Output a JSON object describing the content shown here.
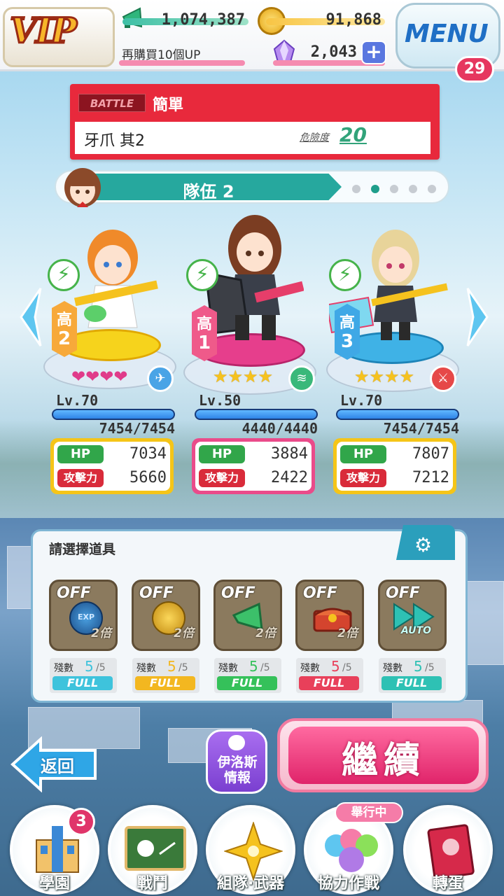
{
  "topbar": {
    "vip": "VIP",
    "cheer_value": "1,074,387",
    "coin_value": "91,868",
    "buy_up": "再購買10個UP",
    "gem_value": "2,043",
    "plus": "+",
    "menu_label": "MENU",
    "menu_badge": "29"
  },
  "battle": {
    "tag": "BATTLE",
    "difficulty": "簡單",
    "stage": "牙爪 其2",
    "danger_label": "危險度",
    "danger_value": "20"
  },
  "team": {
    "name": "隊伍 2",
    "page_count": 5,
    "active_page": 2
  },
  "characters": [
    {
      "rank_label": "高",
      "rank_num": "2",
      "rarity": "hearts",
      "rarity_count": 4,
      "level": "Lv.70",
      "hp_current": "7454/7454",
      "hp_fill": 1.0,
      "hp_label": "HP",
      "hp": "7034",
      "atk_label": "攻擊力",
      "atk": "5660",
      "type_icon": "gun-icon",
      "frame_color": "#f5c518",
      "ped_color": "#f7d21a"
    },
    {
      "rank_label": "高",
      "rank_num": "1",
      "rarity": "stars",
      "rarity_count": 4,
      "level": "Lv.50",
      "hp_current": "4440/4440",
      "hp_fill": 1.0,
      "hp_label": "HP",
      "hp": "3884",
      "atk_label": "攻擊力",
      "atk": "2422",
      "type_icon": "claw-icon",
      "frame_color": "#ea4b8a",
      "ped_color": "#ea3f8a"
    },
    {
      "rank_label": "高",
      "rank_num": "3",
      "rarity": "stars",
      "rarity_count": 4,
      "level": "Lv.70",
      "hp_current": "7454/7454",
      "hp_fill": 1.0,
      "hp_label": "HP",
      "hp": "7807",
      "atk_label": "攻擊力",
      "atk": "7212",
      "type_icon": "sword-icon",
      "frame_color": "#f5c518",
      "ped_color": "#3fb2e6"
    }
  ],
  "items_panel": {
    "title": "請選擇道具",
    "items": [
      {
        "state": "OFF",
        "mult": "2倍",
        "icon": "exp-icon",
        "icon_label": "EXP",
        "remain_label": "殘數",
        "remain": "5",
        "max": "/5",
        "full": "FULL",
        "full_color": "#3ec3dc",
        "num_color": "#3ec3dc"
      },
      {
        "state": "OFF",
        "mult": "2倍",
        "icon": "coin-icon",
        "icon_label": "",
        "remain_label": "殘數",
        "remain": "5",
        "max": "/5",
        "full": "FULL",
        "full_color": "#f3b720",
        "num_color": "#f3b720"
      },
      {
        "state": "OFF",
        "mult": "2倍",
        "icon": "megaphone-icon",
        "icon_label": "",
        "remain_label": "殘數",
        "remain": "5",
        "max": "/5",
        "full": "FULL",
        "full_color": "#35c15a",
        "num_color": "#35c15a"
      },
      {
        "state": "OFF",
        "mult": "2倍",
        "icon": "chest-icon",
        "icon_label": "",
        "remain_label": "殘數",
        "remain": "5",
        "max": "/5",
        "full": "FULL",
        "full_color": "#e8405a",
        "num_color": "#e8405a"
      },
      {
        "state": "OFF",
        "mult": "",
        "icon": "fast-forward-icon",
        "icon_label": "AUTO",
        "remain_label": "殘數",
        "remain": "5",
        "max": "/5",
        "full": "FULL",
        "full_color": "#2ec1b4",
        "num_color": "#2ec1b4"
      }
    ]
  },
  "actions": {
    "back": "返回",
    "info_line1": "伊洛斯",
    "info_line2": "情報",
    "continue": "繼續"
  },
  "nav": {
    "items": [
      {
        "label": "學園",
        "icon": "school-icon"
      },
      {
        "label": "戰鬥",
        "icon": "battle-board-icon"
      },
      {
        "label": "組隊·武器",
        "icon": "compass-star-icon"
      },
      {
        "label": "協力作戰",
        "icon": "balloons-icon"
      },
      {
        "label": "轉蛋",
        "icon": "gacha-book-icon"
      }
    ],
    "school_badge": "3",
    "event_tag": "舉行中"
  }
}
